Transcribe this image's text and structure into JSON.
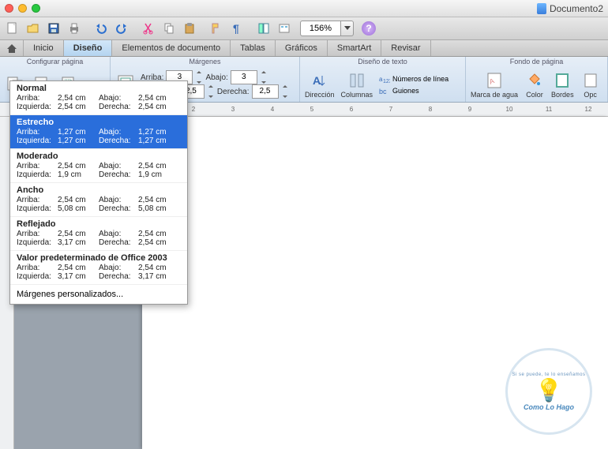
{
  "title": "Documento2",
  "zoom": "156%",
  "tabs": [
    "Inicio",
    "Diseño",
    "Elementos de documento",
    "Tablas",
    "Gráficos",
    "SmartArt",
    "Revisar"
  ],
  "active_tab": 1,
  "ribbon": {
    "group_page": "Configurar página",
    "group_margins": "Márgenes",
    "group_text": "Diseño de texto",
    "group_bg": "Fondo de página",
    "top_label": "Arriba:",
    "bottom_label": "Abajo:",
    "left_label": "Izquierda:",
    "right_label": "Derecha:",
    "top_val": "3",
    "bottom_val": "3",
    "left_val": "2,5",
    "right_val": "2,5",
    "direction": "Dirección",
    "columns": "Columnas",
    "lines": "Números de línea",
    "hyphen": "Guiones",
    "watermark": "Marca de agua",
    "color": "Color",
    "borders": "Bordes",
    "options": "Opc"
  },
  "ruler": [
    "2",
    "3",
    "4",
    "5",
    "6",
    "7",
    "8",
    "9",
    "10",
    "11",
    "12"
  ],
  "margin_presets": [
    {
      "name": "Normal",
      "top": "2,54 cm",
      "bottom": "2,54 cm",
      "left": "2,54 cm",
      "right": "2,54 cm"
    },
    {
      "name": "Estrecho",
      "top": "1,27 cm",
      "bottom": "1,27 cm",
      "left": "1,27 cm",
      "right": "1,27 cm"
    },
    {
      "name": "Moderado",
      "top": "2,54 cm",
      "bottom": "2,54 cm",
      "left": "1,9 cm",
      "right": "1,9 cm"
    },
    {
      "name": "Ancho",
      "top": "2,54 cm",
      "bottom": "2,54 cm",
      "left": "5,08 cm",
      "right": "5,08 cm"
    },
    {
      "name": "Reflejado",
      "top": "2,54 cm",
      "bottom": "2,54 cm",
      "left": "3,17 cm",
      "right": "2,54 cm"
    },
    {
      "name": "Valor predeterminado de Office 2003",
      "top": "2,54 cm",
      "bottom": "2,54 cm",
      "left": "3,17 cm",
      "right": "3,17 cm"
    }
  ],
  "selected_preset": 1,
  "labels": {
    "top": "Arriba:",
    "bottom": "Abajo:",
    "left": "Izquierda:",
    "right": "Derecha:"
  },
  "custom_margins": "Márgenes personalizados...",
  "watermark_text": "Como Lo Hago",
  "watermark_arc": "Si se puede, te lo enseñamos"
}
